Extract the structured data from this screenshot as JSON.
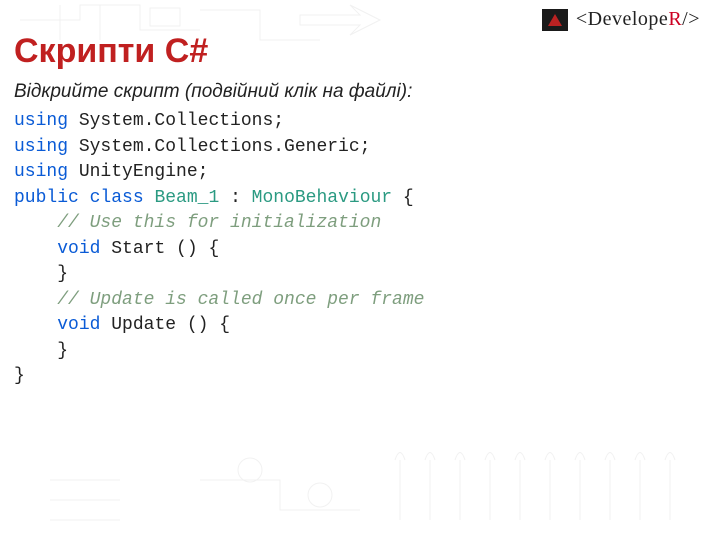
{
  "brand": {
    "text_prefix": "<Develope",
    "text_red": "R",
    "text_suffix": "/>"
  },
  "slide": {
    "title": "Скрипти C#",
    "instruction": "Відкрийте скрипт (подвійний клік на файлі):"
  },
  "code": {
    "l1a": "using",
    "l1b": " System.Collections;",
    "l2a": "using",
    "l2b": " System.Collections.Generic;",
    "l3a": "using",
    "l3b": " UnityEngine;",
    "blank1": "",
    "l4a": "public",
    "l4b": " ",
    "l4c": "class",
    "l4d": " ",
    "l4e": "Beam_1",
    "l4f": " : ",
    "l4g": "MonoBehaviour",
    "l4h": " {",
    "blank2": "",
    "l5": "    // Use this for initialization",
    "l6a": "    ",
    "l6b": "void",
    "l6c": " Start () {",
    "blank3": "",
    "l7": "    }",
    "blank4": "",
    "l8": "    // Update is called once per frame",
    "l9a": "    ",
    "l9b": "void",
    "l9c": " Update () {",
    "blank5": "",
    "l10": "    }",
    "l11": "}"
  }
}
